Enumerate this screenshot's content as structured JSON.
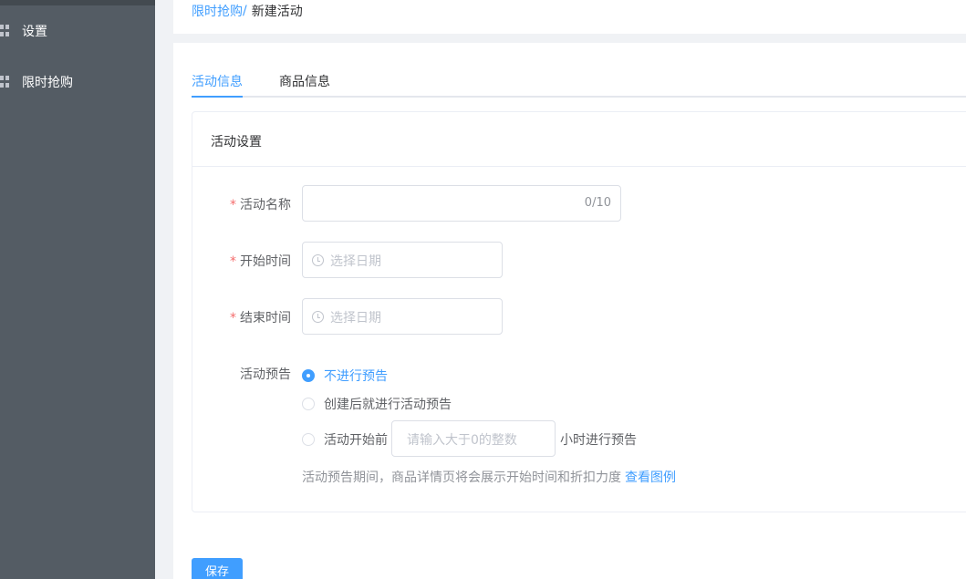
{
  "sidebar": {
    "items": [
      {
        "label": "设置",
        "icon": "grid-icon"
      },
      {
        "label": "限时抢购",
        "icon": "grid-icon"
      }
    ]
  },
  "breadcrumb": {
    "parent": "限时抢购",
    "separator": "/",
    "current": "新建活动"
  },
  "tabs": [
    {
      "label": "活动信息",
      "active": true
    },
    {
      "label": "商品信息",
      "active": false
    }
  ],
  "card": {
    "title": "活动设置"
  },
  "form": {
    "name": {
      "label": "活动名称",
      "required": true,
      "value": "",
      "counter": "0/10"
    },
    "start": {
      "label": "开始时间",
      "required": true,
      "placeholder": "选择日期"
    },
    "end": {
      "label": "结束时间",
      "required": true,
      "placeholder": "选择日期"
    },
    "preview": {
      "label": "活动预告",
      "options": [
        {
          "label": "不进行预告",
          "checked": true
        },
        {
          "label": "创建后就进行活动预告",
          "checked": false
        },
        {
          "label": "活动开始前",
          "checked": false
        }
      ],
      "hours_placeholder": "请输入大于0的整数",
      "hours_suffix": "小时进行预告",
      "hint": "活动预告期间，商品详情页将会展示开始时间和折扣力度",
      "hint_link": "查看图例"
    }
  },
  "actions": {
    "save_label": "保存"
  },
  "colors": {
    "accent": "#409eff",
    "sidebar_bg": "#545c64",
    "required": "#f56c6c"
  }
}
